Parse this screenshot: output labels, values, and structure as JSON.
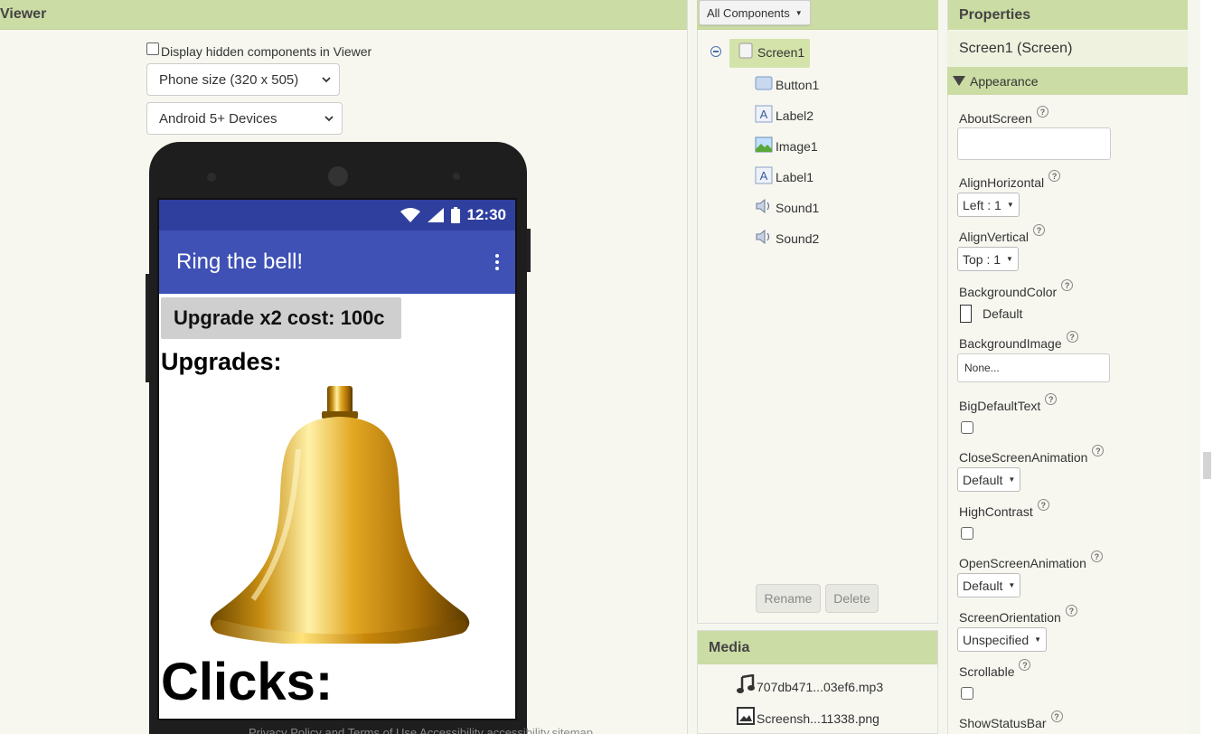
{
  "viewer": {
    "title": "Viewer",
    "hidden_checkbox_label": "Display hidden components in Viewer",
    "phone_size": "Phone size (320 x 505)",
    "device": "Android 5+ Devices"
  },
  "phone": {
    "time": "12:30",
    "app_title": "Ring the bell!",
    "button1": "Upgrade x2 cost: 100c",
    "label2": "Upgrades:",
    "label1": "Clicks:"
  },
  "components": {
    "dropdown": "All Components",
    "tree": {
      "screen": "Screen1",
      "children": [
        "Button1",
        "Label2",
        "Image1",
        "Label1",
        "Sound1",
        "Sound2"
      ]
    },
    "rename": "Rename",
    "delete": "Delete"
  },
  "media": {
    "title": "Media",
    "files": [
      "707db471...03ef6.mp3",
      "Screensh...11338.png"
    ]
  },
  "properties": {
    "title": "Properties",
    "subtitle": "Screen1 (Screen)",
    "section": "Appearance",
    "about_screen": "AboutScreen",
    "align_horizontal": "AlignHorizontal",
    "align_horizontal_value": "Left : 1",
    "align_vertical": "AlignVertical",
    "align_vertical_value": "Top : 1",
    "background_color": "BackgroundColor",
    "background_color_value": "Default",
    "background_image": "BackgroundImage",
    "background_image_value": "None...",
    "big_default_text": "BigDefaultText",
    "close_screen_animation": "CloseScreenAnimation",
    "close_screen_animation_value": "Default",
    "high_contrast": "HighContrast",
    "open_screen_animation": "OpenScreenAnimation",
    "open_screen_animation_value": "Default",
    "screen_orientation": "ScreenOrientation",
    "screen_orientation_value": "Unspecified",
    "scrollable": "Scrollable",
    "show_status_bar": "ShowStatusBar",
    "help_glyph": "?"
  },
  "footer": {
    "text": "Privacy Policy and Terms of Use    Accessibility    accessibility.sitemap"
  },
  "colors": {
    "header_green": "#cbdca4",
    "app_bar": "#3f51b5",
    "status_bar": "#2f3f9e",
    "selection": "#d4e3aa"
  }
}
